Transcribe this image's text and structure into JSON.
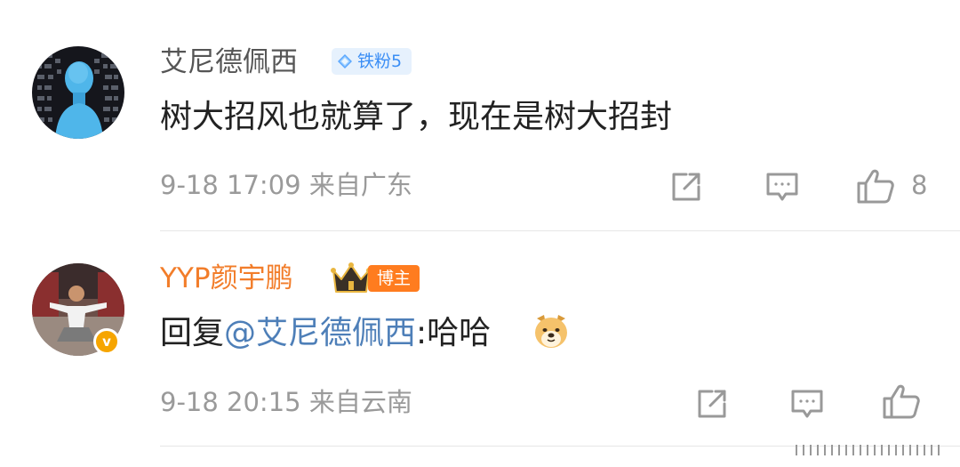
{
  "comments": [
    {
      "username": "艾尼德佩西",
      "badge": "铁粉5",
      "text": "树大招风也就算了，现在是树大招封",
      "time": "9-18 17:09",
      "location": "来自广东",
      "likes": "8"
    },
    {
      "username": "YYP颜宇鹏",
      "badge": "博主",
      "text_prefix": "回复",
      "mention": "@艾尼德佩西",
      "text_suffix": ":哈哈",
      "emoji": "dog-emoji",
      "time": "9-18 20:15",
      "location": "来自云南",
      "verified": "v"
    }
  ],
  "icons": {
    "share": "share-icon",
    "comment": "comment-icon",
    "like": "thumbs-up-icon",
    "fan_gem": "diamond-icon",
    "crown": "crown-icon"
  },
  "colors": {
    "orange_name": "#f27d2a",
    "mention": "#4e7fb8",
    "fan_badge_text": "#3b8ef5",
    "blogger_badge": "#ff7c1f",
    "meta": "#9a9a9a"
  }
}
